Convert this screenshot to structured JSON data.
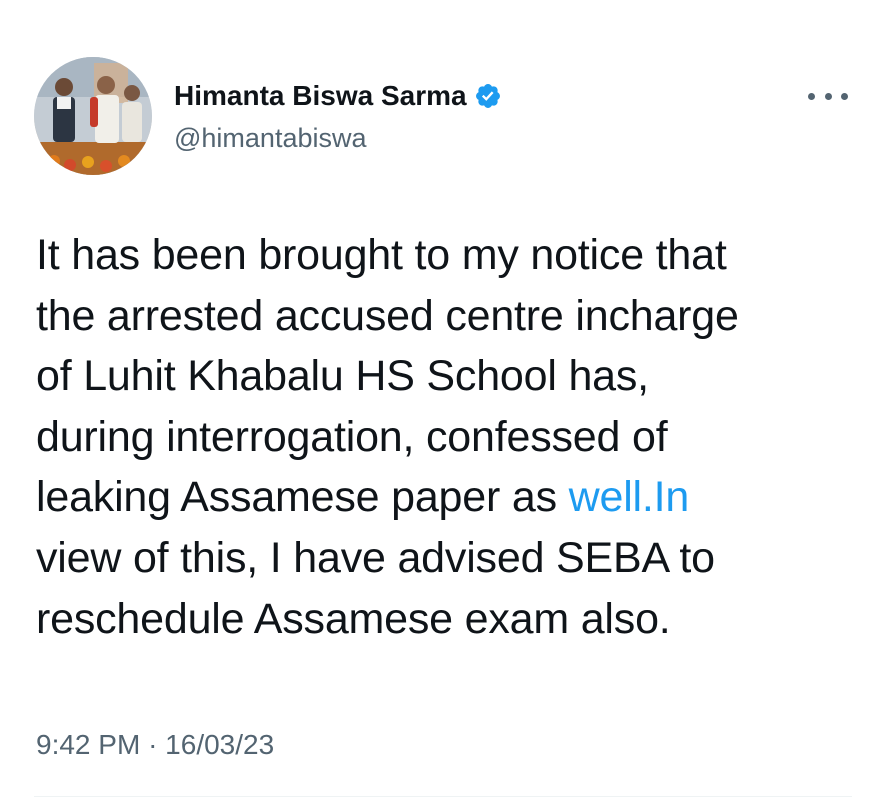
{
  "author": {
    "name": "Himanta Biswa Sarma",
    "handle": "@himantabiswa",
    "verified_icon": "verified-badge-icon",
    "avatar": "profile-photo"
  },
  "tweet": {
    "text_part1": "It has been brought to my notice that\nthe arrested accused centre incharge\nof Luhit Khabalu HS School has,\nduring interrogation, confessed of\nleaking Assamese paper as ",
    "link_text": "well.In",
    "text_part2": "\nview of this, I have advised SEBA to\nreschedule Assamese exam also.",
    "time": "9:42 PM",
    "separator": "·",
    "date": "16/03/23"
  },
  "menu": {
    "icon": "more-options-icon"
  },
  "colors": {
    "text": "#0f1419",
    "secondary": "#536471",
    "link": "#1d9bf0",
    "verified": "#1d9bf0"
  }
}
